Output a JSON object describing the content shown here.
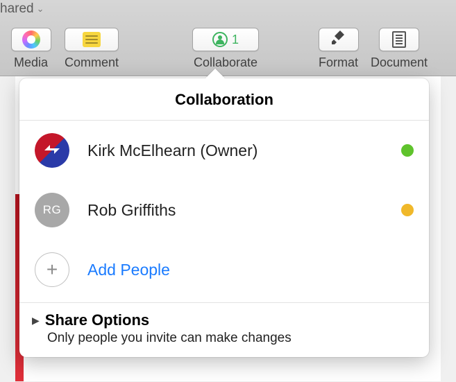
{
  "header": {
    "shared_label": "hared"
  },
  "toolbar": {
    "media": {
      "label": "Media"
    },
    "comment": {
      "label": "Comment"
    },
    "collaborate": {
      "label": "Collaborate",
      "count": "1"
    },
    "format": {
      "label": "Format"
    },
    "document": {
      "label": "Document"
    }
  },
  "popover": {
    "title": "Collaboration",
    "people": [
      {
        "name": "Kirk McElhearn (Owner)",
        "initials": "",
        "status_color": "#5fc32c"
      },
      {
        "name": "Rob Griffiths",
        "initials": "RG",
        "status_color": "#f0b82a"
      }
    ],
    "add_label": "Add People",
    "share": {
      "title": "Share Options",
      "subtitle": "Only people you invite can make changes"
    }
  }
}
